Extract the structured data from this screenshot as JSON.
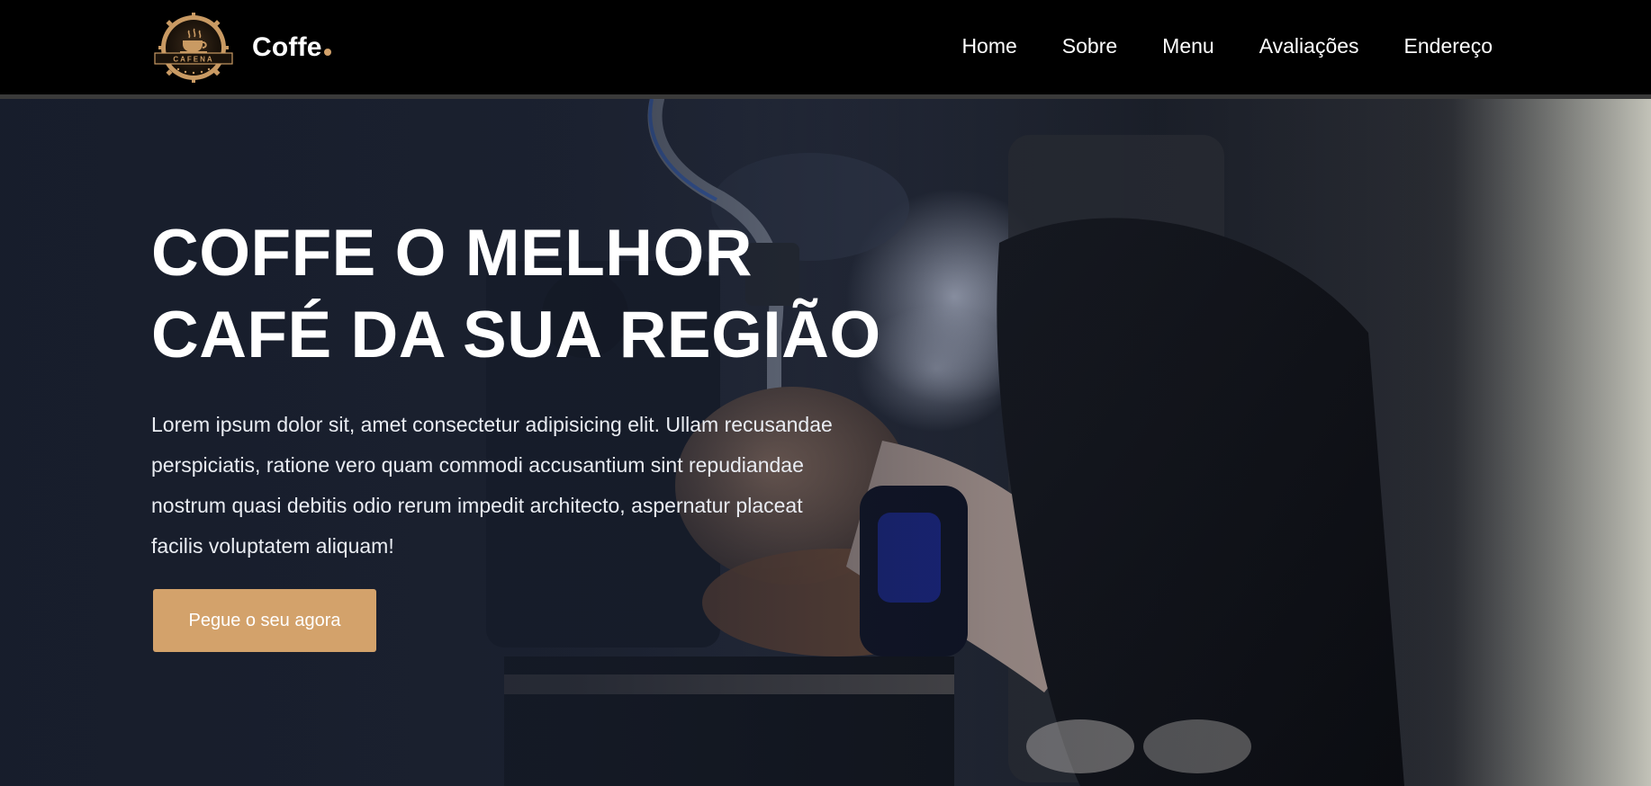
{
  "header": {
    "logo_badge_text": "CAFENA",
    "brand": "Coffe",
    "nav": [
      "Home",
      "Sobre",
      "Menu",
      "Avaliações",
      "Endereço"
    ]
  },
  "hero": {
    "title_line1": "COFFE O MELHOR",
    "title_line2": "CAFÉ DA SUA REGIÃO",
    "text": "Lorem ipsum dolor sit, amet consectetur adipisicing elit. Ullam recusandae perspiciatis, ratione vero quam commodi accusantium sint repudiandae nostrum quasi debitis odio rerum impedit architecto, aspernatur placeat facilis voluptatem aliquam!",
    "cta_label": "Pegue o seu agora"
  },
  "colors": {
    "accent": "#d3a26b",
    "header_bg": "#000000",
    "hero_bg": "#1d2331",
    "text": "#ffffff"
  },
  "icons": {
    "logo": "coffee-cup-badge-icon"
  }
}
